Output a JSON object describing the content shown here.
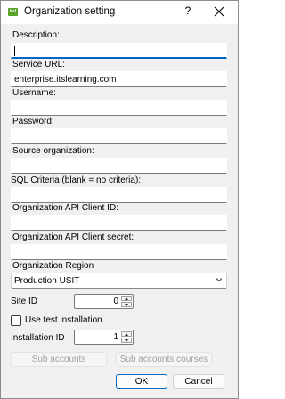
{
  "window": {
    "title": "Organization setting",
    "app_icon_text": "itsl",
    "help_glyph": "?",
    "close_glyph": "X"
  },
  "fields": {
    "description": {
      "label": "Description:",
      "value": ""
    },
    "service_url": {
      "label": "Service URL:",
      "value": "enterprise.itslearning.com"
    },
    "username": {
      "label": "Username:",
      "value": ""
    },
    "password": {
      "label": "Password:",
      "value": ""
    },
    "source_organization": {
      "label": "Source organization:",
      "value": ""
    },
    "sql_criteria": {
      "label": "SQL Criteria (blank = no criteria):",
      "value": ""
    },
    "api_client_id": {
      "label": "Organization API Client ID:",
      "value": ""
    },
    "api_client_secret": {
      "label": "Organization API Client secret:",
      "value": ""
    }
  },
  "region": {
    "label": "Organization Region",
    "selected": "Production USIT"
  },
  "site_id": {
    "label": "Site ID",
    "value": "0"
  },
  "use_test_installation": {
    "label": "Use test installation",
    "checked": false
  },
  "installation_id": {
    "label": "Installation ID",
    "value": "1"
  },
  "buttons": {
    "sub_accounts": "Sub accounts",
    "sub_accounts_courses": "Sub accounts courses",
    "ok": "OK",
    "cancel": "Cancel"
  },
  "colors": {
    "focus_accent": "#0067c0",
    "app_icon": "#5aa22a",
    "dialog_bg": "#f0f0f0"
  }
}
